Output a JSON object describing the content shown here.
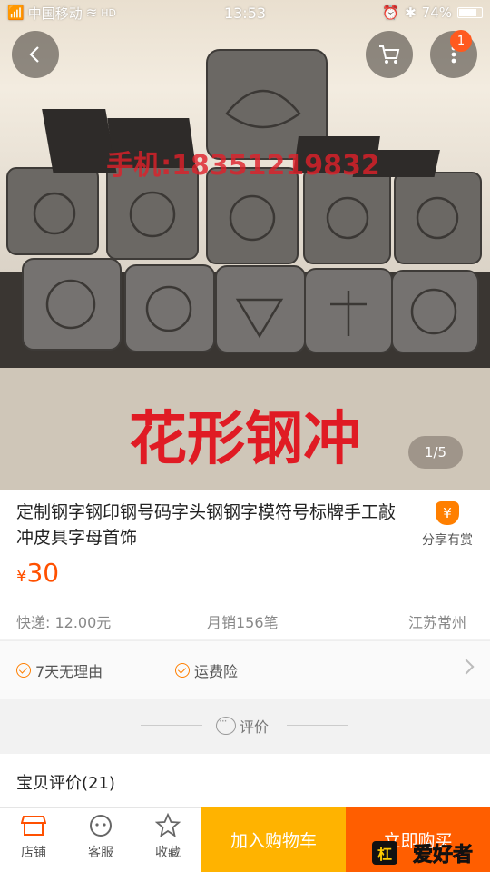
{
  "status_bar": {
    "carrier": "中国移动",
    "network": "HD",
    "time": "13:53",
    "battery": "74%"
  },
  "header": {
    "cart_badge": "1"
  },
  "gallery": {
    "image_overlay_text": "花形钢冲",
    "image_watermark": "手机:18351219832",
    "pager": "1/5"
  },
  "product": {
    "title": "定制钢字钢印钢号码字头钢钢字模符号标牌手工敲冲皮具字母首饰",
    "share_label": "分享有赏",
    "currency": "¥",
    "price": "30",
    "shipping": "快递: 12.00元",
    "monthly_sales": "月销156笔",
    "location": "江苏常州"
  },
  "services": {
    "items": [
      "7天无理由",
      "运费险"
    ]
  },
  "review_section": {
    "tab_label": "评价",
    "title": "宝贝评价(21)"
  },
  "bottom_bar": {
    "shop_label": "店铺",
    "service_label": "客服",
    "favorite_label": "收藏",
    "add_to_cart": "加入购物车",
    "buy_now": "立即购买",
    "watermark": "爱好者"
  },
  "colors": {
    "price_orange": "#ff5000",
    "add_cart_yellow": "#ffb300",
    "buy_now_orange": "#ff5e00"
  }
}
